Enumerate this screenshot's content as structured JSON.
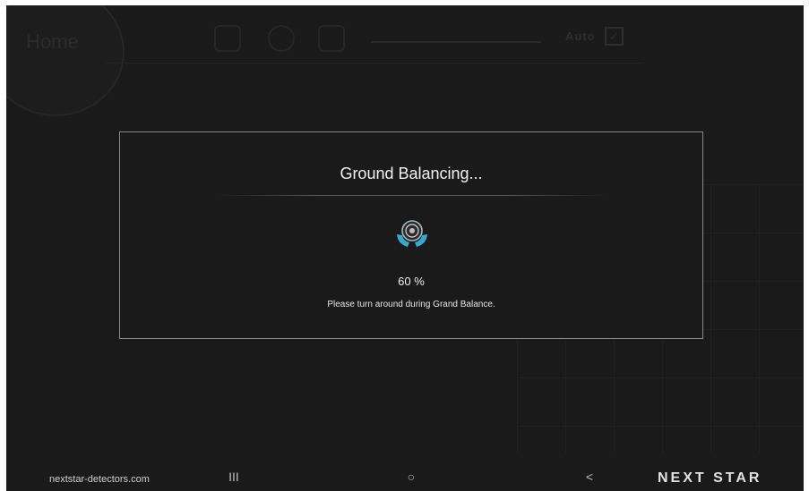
{
  "background_app": {
    "home_label": "Home",
    "auto_label": "Auto",
    "auto_checked": true
  },
  "dialog": {
    "title": "Ground Balancing...",
    "icon": "ground-balance-icon",
    "progress_text": "60 %",
    "progress_value": 60,
    "message": "Please turn around during Grand Balance."
  },
  "navbar": {
    "website": "nextstar-detectors.com",
    "recents_glyph": "III",
    "home_glyph": "○",
    "back_glyph": "<",
    "brand": "NEXT STAR"
  },
  "colors": {
    "screen_bg": "#1a1a1a",
    "dialog_border": "#8a8a8a",
    "icon_accent": "#3aa9c9"
  }
}
